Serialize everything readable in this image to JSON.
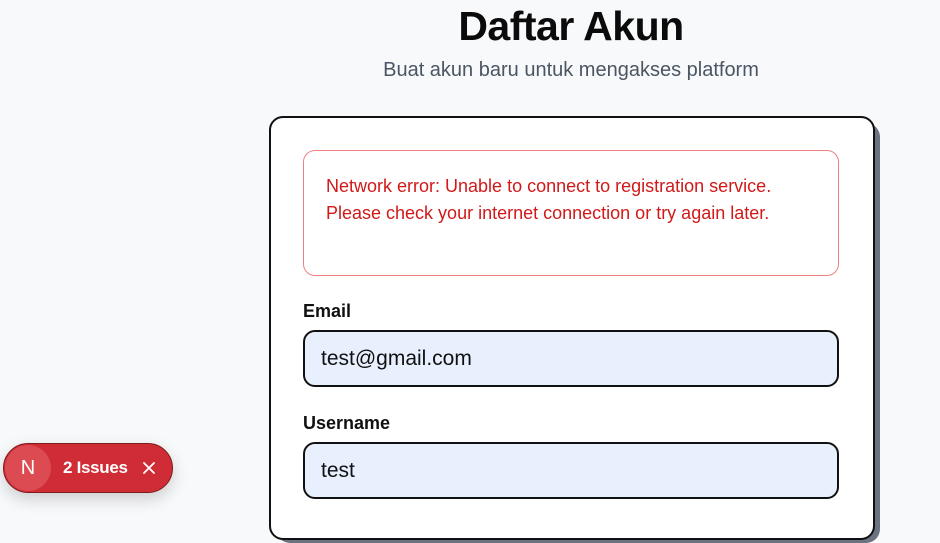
{
  "page": {
    "title": "Daftar Akun",
    "subtitle": "Buat akun baru untuk mengakses platform"
  },
  "form": {
    "error_message": "Network error: Unable to connect to registration service. Please check your internet connection or try again later.",
    "email_label": "Email",
    "email_value": "test@gmail.com",
    "username_label": "Username",
    "username_value": "test"
  },
  "dev_overlay": {
    "badge_letter": "N",
    "issues_label": "2 Issues",
    "close_icon": "close-icon"
  },
  "colors": {
    "error_text": "#d11919",
    "error_border": "#f08080",
    "input_bg": "#e8f0fe",
    "issues_pill": "#cf2c35"
  }
}
